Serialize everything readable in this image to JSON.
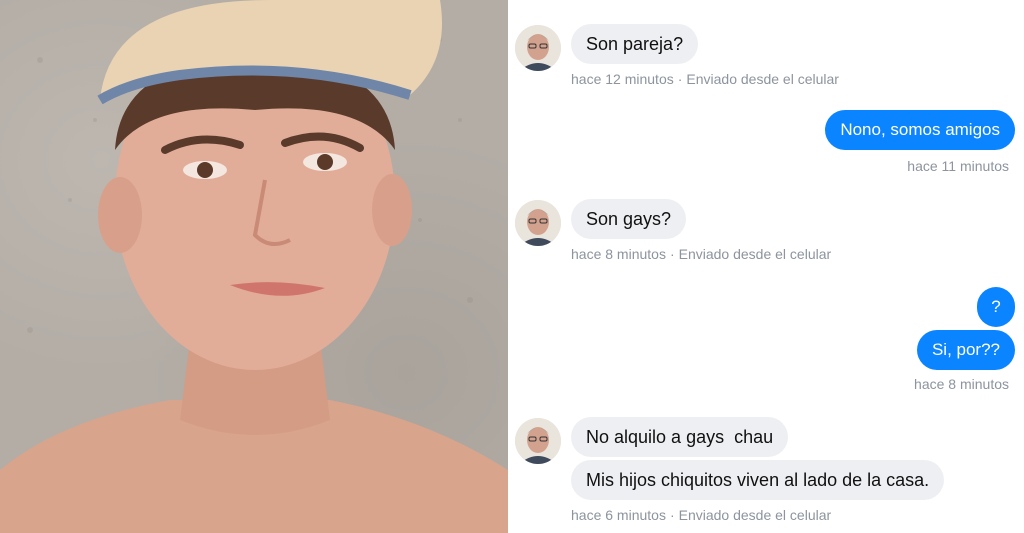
{
  "conversation": {
    "messages": [
      {
        "direction": "incoming",
        "text": "Son pareja?",
        "time": "hace 12 minutos",
        "device": "Enviado desde el celular"
      },
      {
        "direction": "outgoing",
        "text": "Nono, somos amigos",
        "time": "hace 11 minutos"
      },
      {
        "direction": "incoming",
        "text": "Son gays?",
        "time": "hace 8 minutos",
        "device": "Enviado desde el celular"
      },
      {
        "direction": "outgoing",
        "text": "?"
      },
      {
        "direction": "outgoing",
        "text": "Si, por??",
        "time": "hace 8 minutos"
      },
      {
        "direction": "incoming",
        "text": "No alquilo a gays  chau"
      },
      {
        "direction": "incoming",
        "text": "Mis hijos chiquitos viven al lado de la casa.",
        "time": "hace 6 minutos",
        "device": "Enviado desde el celular"
      }
    ],
    "separator": "·"
  },
  "colors": {
    "outgoing_bubble": "#0b84ff",
    "incoming_bubble": "#eeeff2",
    "meta_text": "#8d949e"
  }
}
